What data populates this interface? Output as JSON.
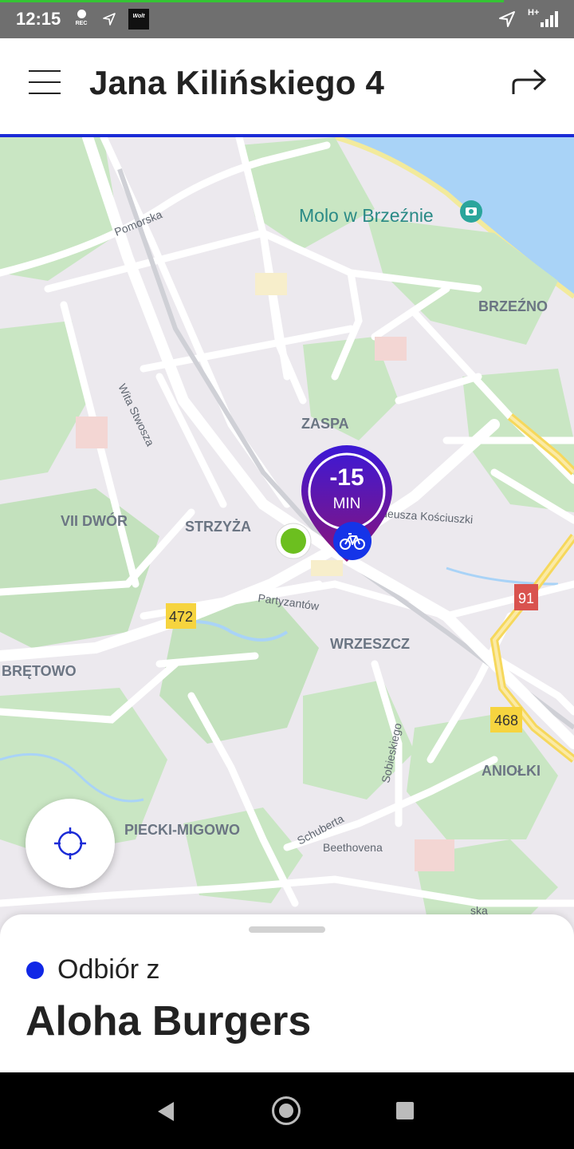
{
  "status_bar": {
    "time": "12:15",
    "rec_label": "REC",
    "wolt_badge": "Wolt",
    "network": "H+",
    "icons": [
      "rec-icon",
      "location-arrow-icon",
      "wolt-app-icon",
      "location-arrow-icon",
      "signal-icon"
    ]
  },
  "header": {
    "title": "Jana Kilińskiego 4",
    "menu_icon": "hamburger-menu-icon",
    "share_icon": "share-arrow-icon",
    "accent_color": "#1b2bd6"
  },
  "map": {
    "poi": "Molo w Brzeźnie",
    "districts": [
      "BRZEŹNO",
      "ZASPA",
      "VII DWÓR",
      "STRZYŻA",
      "WRZESZCZ",
      "BRĘTOWO",
      "ANIOŁKI",
      "PIECKI-MIGOWO"
    ],
    "streets": [
      "Pomorska",
      "Wita Stwosza",
      "Partyzantów",
      "Sobieskiego",
      "Schuberta",
      "Beethovena"
    ],
    "street_kosciuszki": "deusza Kościuszki",
    "street_partial": "ska",
    "road_numbers": [
      "472",
      "91",
      "468"
    ],
    "marker": {
      "value": "-15",
      "unit": "MIN",
      "icon": "bicycle-icon"
    },
    "origin_marker_color": "#6cbf1f"
  },
  "locate_button": {
    "icon": "crosshair-locate-icon"
  },
  "bottom_sheet": {
    "pickup_label": "Odbiór z",
    "restaurant": "Aloha Burgers",
    "dot_color": "#1027e6"
  },
  "nav_bar": {
    "icons": [
      "back-triangle-icon",
      "home-circle-icon",
      "recent-apps-square-icon"
    ]
  }
}
